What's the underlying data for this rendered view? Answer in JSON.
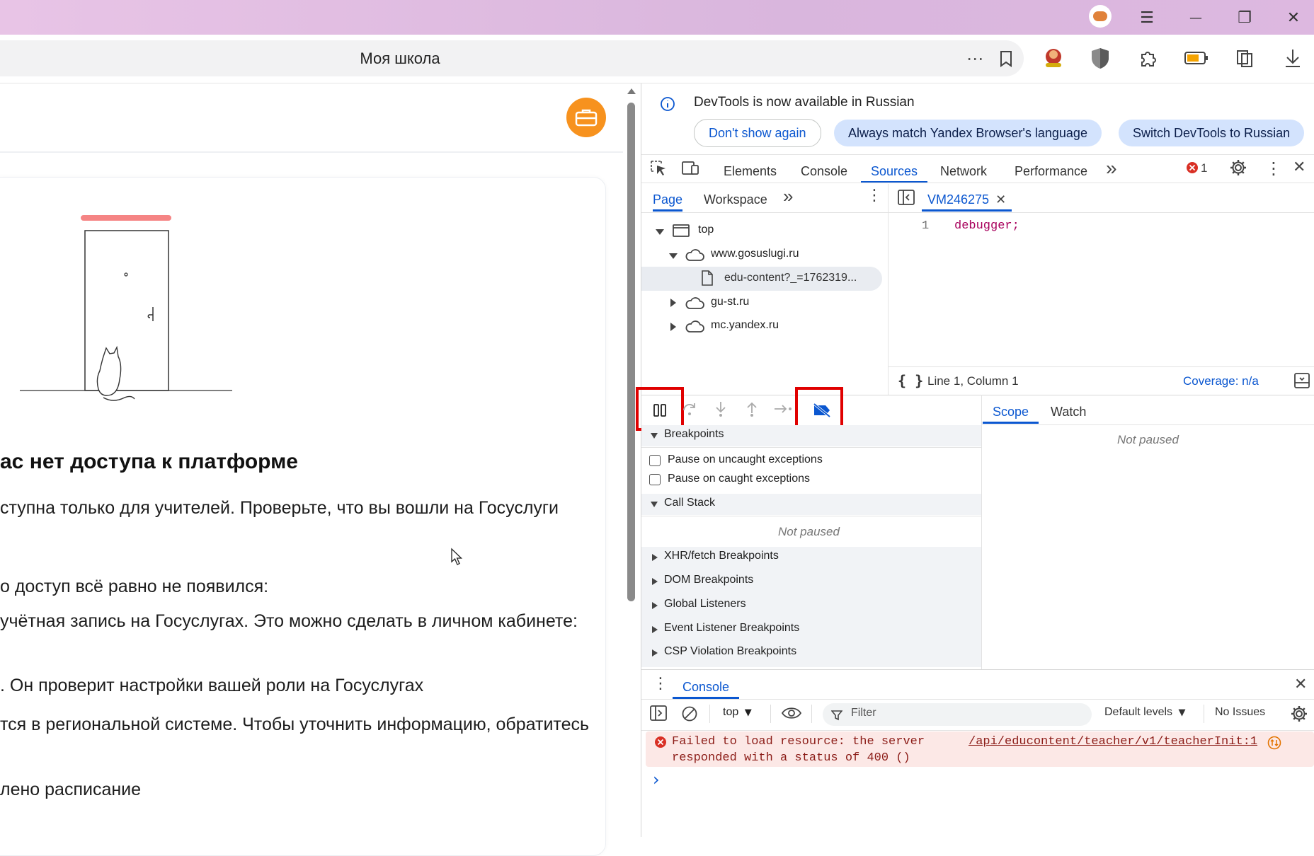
{
  "window": {
    "minimize": "—",
    "restore": "❐",
    "close": "✕",
    "menu": "☰"
  },
  "addressbar": {
    "title": "Моя школа",
    "more": "⋯"
  },
  "page": {
    "heading": "ас нет доступа к платформе",
    "lines": [
      "ступна только для учителей. Проверьте, что вы вошли на Госуслуги",
      "о доступ всё равно не появился:",
      " учётная запись на Госуслугах. Это можно сделать в личном кабинете:",
      ". Он проверит настройки вашей роли на Госуслугах",
      "тся в региональной системе. Чтобы уточнить информацию, обратитесь",
      "лено расписание"
    ]
  },
  "devtools": {
    "banner": {
      "message": "DevTools is now available in Russian",
      "btn_dont_show": "Don't show again",
      "btn_always_match": "Always match Yandex Browser's language",
      "btn_switch": "Switch DevTools to Russian"
    },
    "main_tabs": [
      "Elements",
      "Console",
      "Sources",
      "Network",
      "Performance"
    ],
    "more_tabs": "»",
    "error_count": "1",
    "navigator": {
      "tabs": [
        "Page",
        "Workspace"
      ],
      "tree": {
        "top": "top",
        "gosuslugi": "www.gosuslugi.ru",
        "file": "edu-content?_=1762319...",
        "gust": "gu-st.ru",
        "yandex": "mc.yandex.ru"
      }
    },
    "editor": {
      "file_tab": "VM246275",
      "line_number": "1",
      "code": "debugger;",
      "status_position": "Line 1, Column 1",
      "coverage": "Coverage: n/a"
    },
    "debugger": {
      "breakpoints_header": "Breakpoints",
      "pause_uncaught": "Pause on uncaught exceptions",
      "pause_caught": "Pause on caught exceptions",
      "callstack_header": "Call Stack",
      "not_paused": "Not paused",
      "sections": [
        "XHR/fetch Breakpoints",
        "DOM Breakpoints",
        "Global Listeners",
        "Event Listener Breakpoints",
        "CSP Violation Breakpoints"
      ],
      "scope_tab": "Scope",
      "watch_tab": "Watch",
      "scope_not_paused": "Not paused"
    },
    "console": {
      "tab": "Console",
      "context": "top",
      "filter_placeholder": "Filter",
      "levels": "Default levels",
      "issues": "No Issues",
      "error_text_1": "Failed to load resource: the server",
      "error_text_2": "responded with a status of 400 ()",
      "error_link": "/api/educontent/teacher/v1/teacherInit:1",
      "prompt": "›"
    }
  },
  "colors": {
    "accent": "#0b57d0",
    "highlight": "#e00000",
    "error": "#d93025",
    "briefcase": "#f7921e"
  }
}
